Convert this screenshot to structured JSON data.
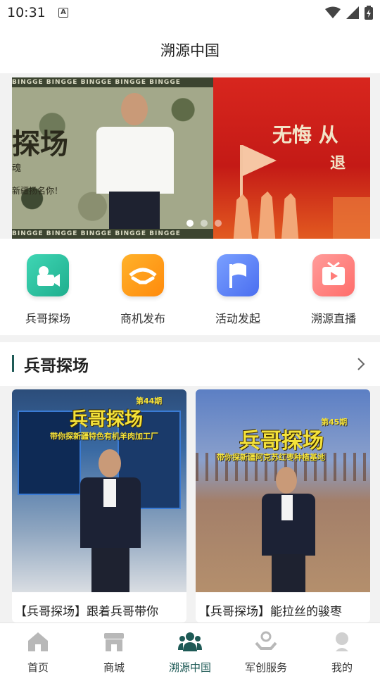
{
  "status_bar": {
    "time": "10:31",
    "notification_icon": "A"
  },
  "header": {
    "title": "溯源中国"
  },
  "banner": {
    "slides": [
      {
        "strip_text": "BINGGE BINGGE BINGGE BINGGE BINGGE",
        "title_fragment": "探场",
        "line_1": "魂",
        "line_2": "新疆扬名你！"
      },
      {
        "title_fragment": "无悔 从",
        "line_2": "退"
      }
    ],
    "active_index": 0,
    "dot_count": 3
  },
  "quick_actions": [
    {
      "label": "兵哥探场",
      "icon": "video-camera-icon",
      "color_from": "#3fd6b4",
      "color_to": "#1fae8e"
    },
    {
      "label": "商机发布",
      "icon": "handshake-icon",
      "color_from": "#ffb22a",
      "color_to": "#ff8a0c"
    },
    {
      "label": "活动发起",
      "icon": "flag-icon",
      "color_from": "#7aa0ff",
      "color_to": "#4a6ef0"
    },
    {
      "label": "溯源直播",
      "icon": "tv-icon",
      "color_from": "#ff9c9a",
      "color_to": "#ff6d6a"
    }
  ],
  "section": {
    "title": "兵哥探场"
  },
  "cards": [
    {
      "caption": "【兵哥探场】跟着兵哥带你",
      "art_title": "兵哥探场",
      "issue": "第44期",
      "subtitle": "带你探新疆特色有机羊肉加工厂"
    },
    {
      "caption": "【兵哥探场】能拉丝的骏枣",
      "art_title": "兵哥探场",
      "issue": "第45期",
      "subtitle": "带你探新疆阿克苏红枣种植基地"
    }
  ],
  "tabbar": {
    "active_index": 2,
    "accent_color": "#1e5a56",
    "items": [
      {
        "label": "首页",
        "icon": "home-icon"
      },
      {
        "label": "商城",
        "icon": "store-icon"
      },
      {
        "label": "溯源中国",
        "icon": "people-icon"
      },
      {
        "label": "军创服务",
        "icon": "service-hand-icon"
      },
      {
        "label": "我的",
        "icon": "profile-icon"
      }
    ]
  }
}
